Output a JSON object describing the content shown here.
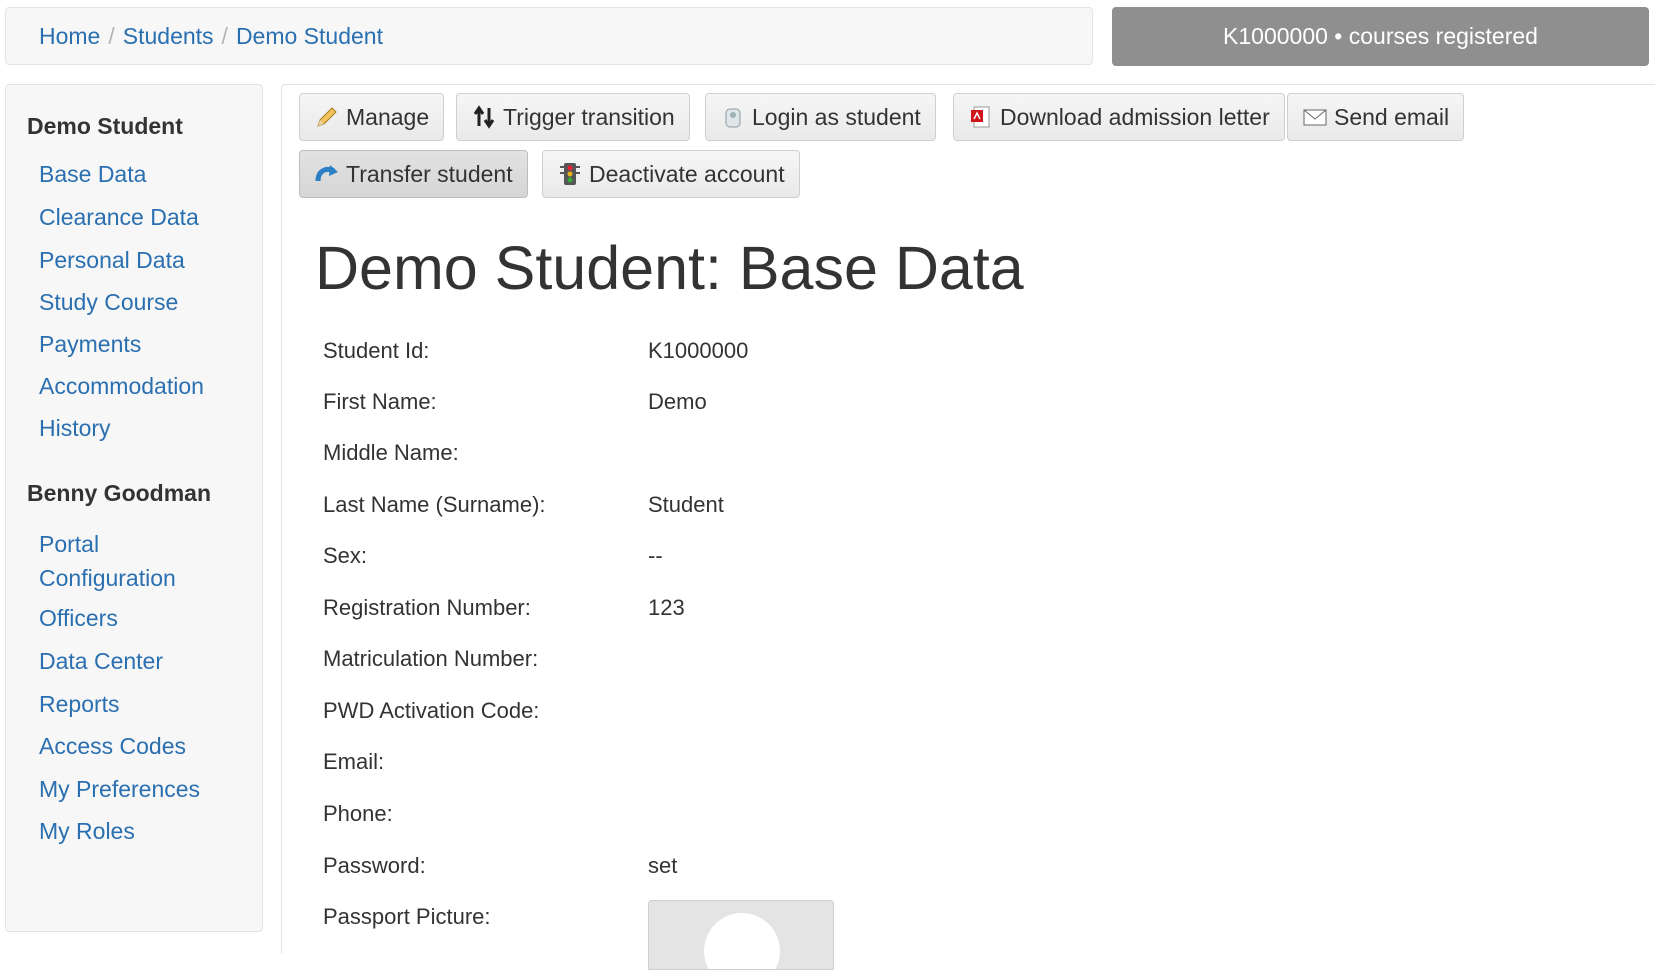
{
  "breadcrumb": {
    "items": [
      "Home",
      "Students",
      "Demo Student"
    ],
    "separator": "/"
  },
  "status_badge": "K1000000 • courses registered",
  "sidebar": {
    "student_heading": "Demo Student",
    "student_links": [
      "Base Data",
      "Clearance Data",
      "Personal Data",
      "Study Course",
      "Payments",
      "Accommodation",
      "History"
    ],
    "user_heading": "Benny Goodman",
    "user_links": [
      "Portal Configuration",
      "Officers",
      "Data Center",
      "Reports",
      "Access Codes",
      "My Preferences",
      "My Roles"
    ]
  },
  "toolbar": {
    "buttons": [
      {
        "label": "Manage",
        "icon": "pencil-icon"
      },
      {
        "label": "Trigger transition",
        "icon": "transition-arrows-icon"
      },
      {
        "label": "Login as student",
        "icon": "login-icon"
      },
      {
        "label": "Download admission letter",
        "icon": "pdf-icon"
      },
      {
        "label": "Send email",
        "icon": "envelope-icon"
      },
      {
        "label": "Transfer student",
        "icon": "transfer-icon"
      },
      {
        "label": "Deactivate account",
        "icon": "traffic-light-icon"
      }
    ]
  },
  "page_title": "Demo Student: Base Data",
  "fields": [
    {
      "label": "Student Id:",
      "value": "K1000000"
    },
    {
      "label": "First Name:",
      "value": "Demo"
    },
    {
      "label": "Middle Name:",
      "value": ""
    },
    {
      "label": "Last Name (Surname):",
      "value": "Student"
    },
    {
      "label": "Sex:",
      "value": "--"
    },
    {
      "label": "Registration Number:",
      "value": "123"
    },
    {
      "label": "Matriculation Number:",
      "value": ""
    },
    {
      "label": "PWD Activation Code:",
      "value": ""
    },
    {
      "label": "Email:",
      "value": ""
    },
    {
      "label": "Phone:",
      "value": ""
    },
    {
      "label": "Password:",
      "value": "set"
    },
    {
      "label": "Passport Picture:",
      "value": ""
    }
  ],
  "colors": {
    "link": "#2a6fb0",
    "badge_bg": "#8f8f8f",
    "panel_bg": "#f7f7f7"
  }
}
